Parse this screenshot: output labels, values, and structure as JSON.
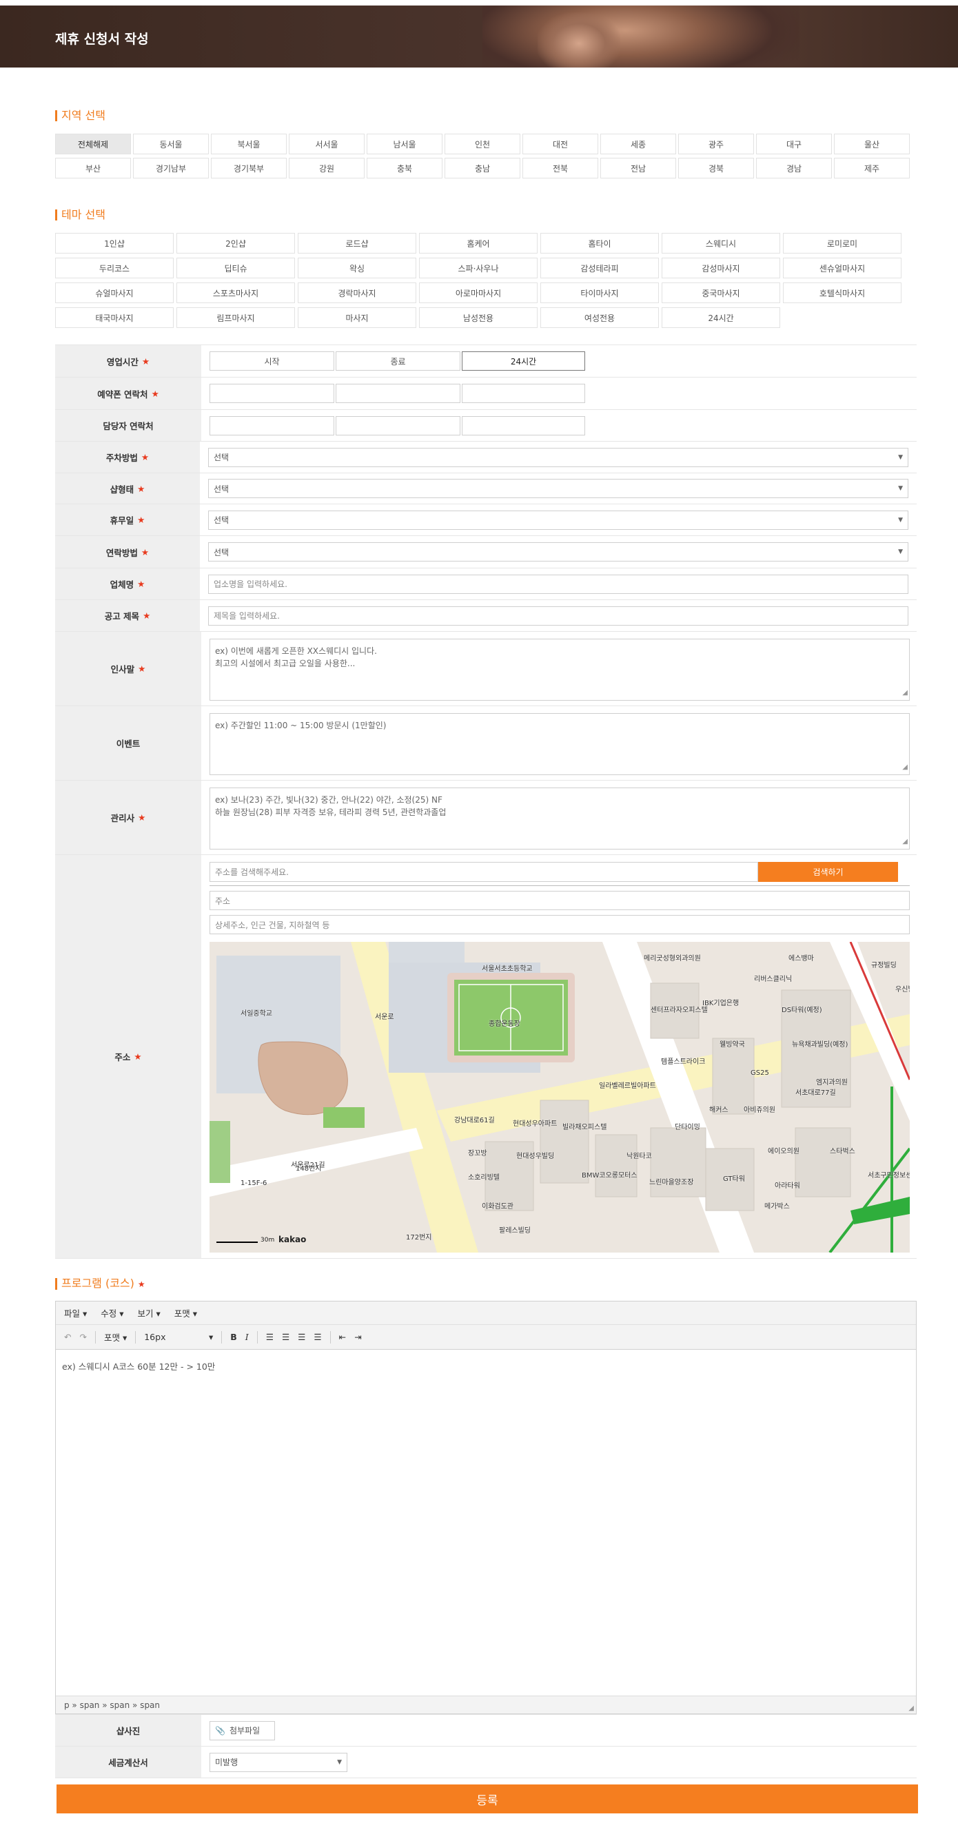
{
  "header": {
    "title": "제휴 신청서 작성"
  },
  "region": {
    "title": "지역 선택",
    "items": [
      "전체해제",
      "동서울",
      "북서울",
      "서서울",
      "남서울",
      "인천",
      "대전",
      "세종",
      "광주",
      "대구",
      "울산",
      "부산",
      "경기남부",
      "경기북부",
      "강원",
      "충북",
      "충남",
      "전북",
      "전남",
      "경북",
      "경남",
      "제주"
    ],
    "selected": "전체해제"
  },
  "theme": {
    "title": "테마 선택",
    "items": [
      "1인샵",
      "2인샵",
      "로드샵",
      "홈케어",
      "홈타이",
      "스웨디시",
      "로미로미",
      "두리코스",
      "딥티슈",
      "왁싱",
      "스파·사우나",
      "감성테라피",
      "감성마사지",
      "센슈얼마사지",
      "슈얼마사지",
      "스포츠마사지",
      "경락마사지",
      "아로마마사지",
      "타이마사지",
      "중국마사지",
      "호텔식마사지",
      "태국마사지",
      "림프마사지",
      "마사지",
      "남성전용",
      "여성전용",
      "24시간"
    ]
  },
  "form": {
    "hours": {
      "label": "영업시간",
      "start": "시작",
      "end": "종료",
      "allday": "24시간"
    },
    "contact": {
      "label": "예약폰 연락처"
    },
    "manager": {
      "label": "담당자 연락처"
    },
    "parking": {
      "label": "주차방법",
      "value": "선택"
    },
    "shoptype": {
      "label": "샵형태",
      "value": "선택"
    },
    "holiday": {
      "label": "휴무일",
      "value": "선택"
    },
    "contactmethod": {
      "label": "연락방법",
      "value": "선택"
    },
    "bizname": {
      "label": "업체명",
      "placeholder": "업소명을 입력하세요."
    },
    "adtitle": {
      "label": "공고 제목",
      "placeholder": "제목을 입력하세요."
    },
    "greeting": {
      "label": "인사말",
      "placeholder": "ex) 이번에 새롭게 오픈한 XX스웨디시 입니다.\n최고의 시설에서 최고급 오일을 사용한..."
    },
    "event": {
      "label": "이벤트",
      "placeholder": "ex) 주간할인 11:00 ~ 15:00 방문시 (1만할인)"
    },
    "therapist": {
      "label": "관리사",
      "placeholder": "ex) 보나(23) 주간, 빛나(32) 중간, 안나(22) 야간, 소정(25) NF\n하늘 원장님(28) 피부 자격증 보유, 테라피 경력 5년, 관련학과졸업"
    },
    "address": {
      "label": "주소",
      "search_placeholder": "주소를 검색해주세요.",
      "search_button": "검색하기",
      "addr_placeholder": "주소",
      "detail_placeholder": "상세주소, 인근 건물, 지하철역 등"
    }
  },
  "map": {
    "labels": [
      "서울서초초등학교",
      "서일중학교",
      "종합운동장",
      "메리굿성형외과의원",
      "에스뱅마",
      "규정빌딩",
      "우신빌",
      "리버스클리닉",
      "센터프라자오피스텔",
      "IBK기업은행",
      "DS타워(예정)",
      "뉴욕채과빌딩(예정)",
      "웰빙약국",
      "GS25",
      "엠지과의원",
      "템플스트라이크",
      "일라벨레르빌아파트",
      "현대성우아파트",
      "빌라채오피스텔",
      "단타이밍",
      "해커스",
      "아비쥬의원",
      "에이오의원",
      "스타벅스",
      "서초구민정보센터",
      "장꼬방",
      "현대성우빌딩",
      "낙원타코",
      "소호리빙텔",
      "BMW코오롱모터스",
      "느린마을양조장",
      "GT타워",
      "아라타워",
      "메가박스",
      "이화검도관",
      "팔레스빌딩",
      "서운로",
      "서운로21길",
      "강남대로61길",
      "서초대로77길",
      "148번지",
      "1-15F-6",
      "172번지"
    ],
    "scale": "30m",
    "brand": "kakao"
  },
  "program": {
    "title": "프로그램 (코스)",
    "menu": [
      "파일",
      "수정",
      "보기",
      "포맷"
    ],
    "format_label": "포맷",
    "font_size": "16px",
    "content": "ex) 스웨디시 A코스 60분 12만 - > 10만",
    "status": "p » span » span » span"
  },
  "photo": {
    "label": "샵사진",
    "button": "첨부파일"
  },
  "tax": {
    "label": "세금계산서",
    "value": "미발행"
  },
  "submit": {
    "label": "등록"
  }
}
